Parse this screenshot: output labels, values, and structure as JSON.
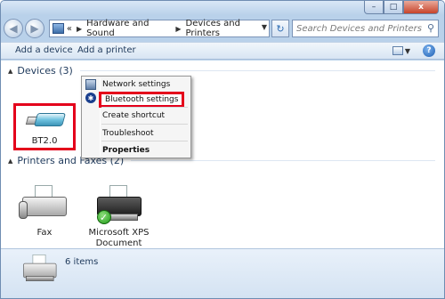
{
  "window": {
    "caption_minimize": "–",
    "caption_maximize": "□",
    "caption_close": "x"
  },
  "navigation": {
    "back_glyph": "◀",
    "forward_glyph": "▶",
    "breadcrumb_overflow": "«",
    "breadcrumb": [
      "Hardware and Sound",
      "Devices and Printers"
    ],
    "separator": "▶",
    "dropdown_glyph": "▼",
    "refresh_glyph": "↻",
    "search_placeholder": "Search Devices and Printers"
  },
  "commandbar": {
    "add_device": "Add a device",
    "add_printer": "Add a printer",
    "view_caret": "▼",
    "help": "?"
  },
  "groups": {
    "devices": {
      "label": "Devices (3)",
      "toggle": "▲"
    },
    "printers": {
      "label": "Printers and Faxes (2)",
      "toggle": "▲"
    }
  },
  "devices": [
    {
      "label": "BT2.0",
      "icon": "usb-bluetooth-dongle-icon",
      "selected": true
    }
  ],
  "printers": [
    {
      "label": "Fax",
      "icon": "fax-icon"
    },
    {
      "label": "Microsoft XPS Document Writer",
      "icon": "printer-icon",
      "default": true
    }
  ],
  "context_menu": {
    "items": [
      {
        "label": "Network settings",
        "icon": "network-icon"
      },
      {
        "label": "Bluetooth settings",
        "icon": "bluetooth-icon",
        "highlighted": true
      },
      {
        "label": "Create shortcut"
      },
      {
        "label": "Troubleshoot"
      },
      {
        "label": "Properties",
        "bold": true
      }
    ],
    "bluetooth_glyph": "✱"
  },
  "details": {
    "count": "6 items"
  },
  "colors": {
    "highlight_box": "#e4001b",
    "window_frame": "#b9d1ea",
    "link_text": "#1e395b"
  }
}
